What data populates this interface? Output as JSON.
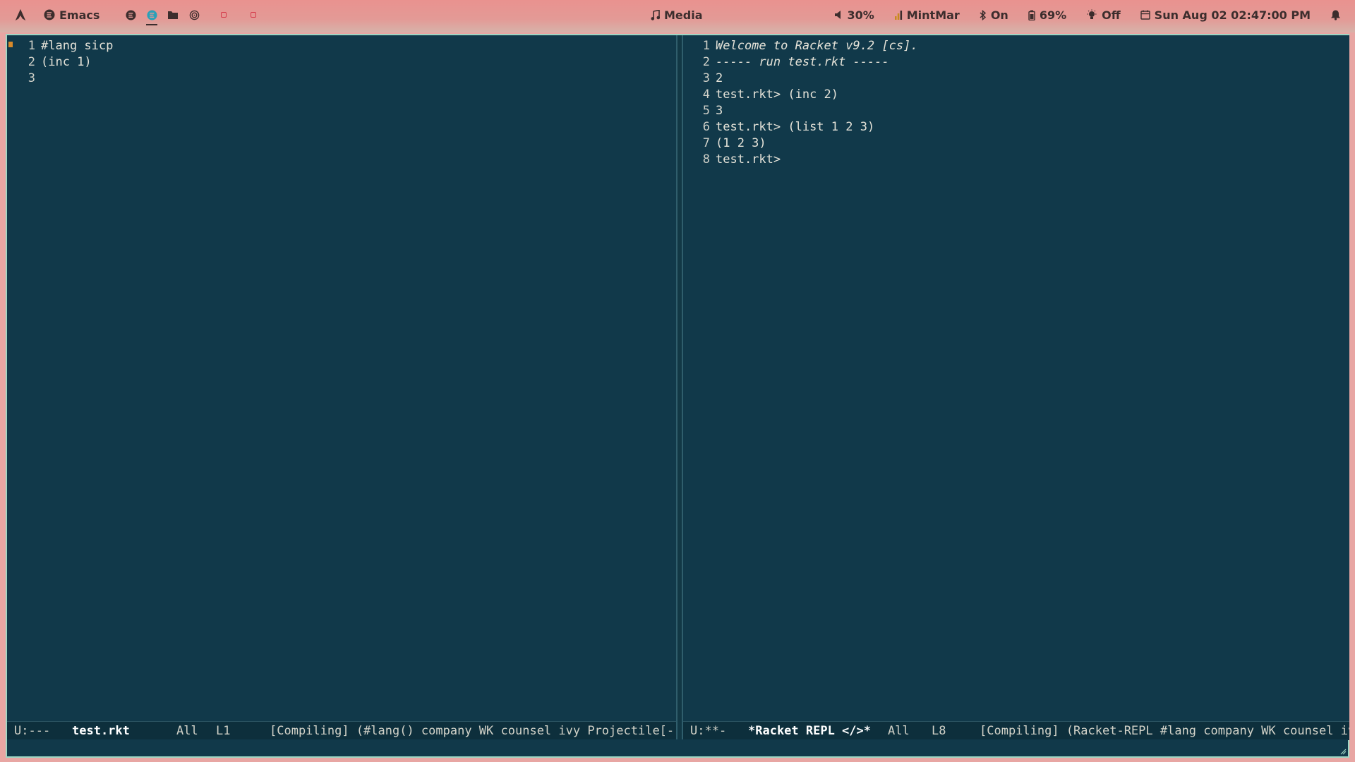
{
  "topbar": {
    "app_name": "Emacs",
    "media_label": "Media",
    "volume": "30%",
    "network": "MintMar",
    "bluetooth": "On",
    "battery": "69%",
    "brightness": "Off",
    "datetime": "Sun Aug 02 02:47:00 PM",
    "colors": {
      "workspace_inactive": "#d43a4a",
      "workspace_active": "#2aa0b8"
    }
  },
  "left_pane": {
    "lines": [
      {
        "num": "1",
        "text": "#lang sicp"
      },
      {
        "num": "2",
        "text": "(inc 1)"
      },
      {
        "num": "3",
        "text": ""
      }
    ],
    "modeline": {
      "status": "U:---",
      "buffer": "test.rkt",
      "position": "All",
      "line": "L1",
      "modes": "[Compiling] (#lang() company WK counsel ivy Projectile[-])"
    }
  },
  "right_pane": {
    "lines": [
      {
        "num": "1",
        "text": "Welcome to Racket v9.2 [cs].",
        "italic": true
      },
      {
        "num": "2",
        "text": "----- run test.rkt -----",
        "italic": true
      },
      {
        "num": "3",
        "text": "2"
      },
      {
        "num": "4",
        "prompt": "test.rkt>",
        "text": " (inc 2)"
      },
      {
        "num": "5",
        "text": "3"
      },
      {
        "num": "6",
        "prompt": "test.rkt>",
        "text": " (list 1 2 3)"
      },
      {
        "num": "7",
        "text": "(1 2 3)"
      },
      {
        "num": "8",
        "prompt": "test.rkt>",
        "text": ""
      }
    ],
    "modeline": {
      "status": "U:**-",
      "buffer": "*Racket REPL </>*",
      "position": "All",
      "line": "L8",
      "modes": "[Compiling] (Racket-REPL #lang company WK counsel ivy"
    }
  }
}
